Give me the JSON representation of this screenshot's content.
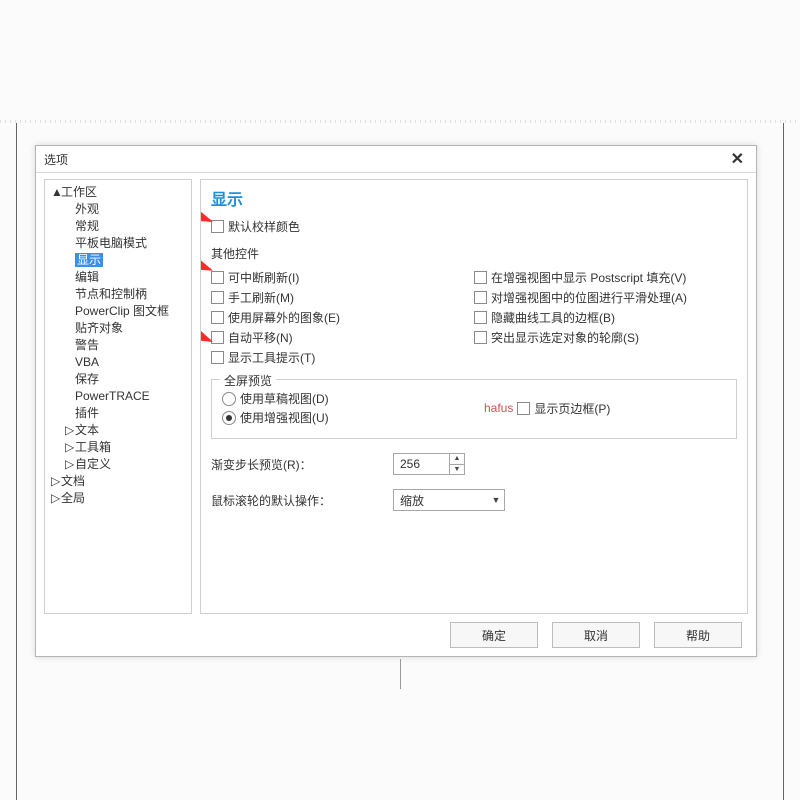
{
  "dialog": {
    "title": "选项"
  },
  "tree": {
    "items": [
      {
        "label": "工作区",
        "level": 0,
        "expander": "▲"
      },
      {
        "label": "外观",
        "level": 1
      },
      {
        "label": "常规",
        "level": 1
      },
      {
        "label": "平板电脑模式",
        "level": 1
      },
      {
        "label": "显示",
        "level": 1,
        "selected": true
      },
      {
        "label": "编辑",
        "level": 1
      },
      {
        "label": "节点和控制柄",
        "level": 1
      },
      {
        "label": "PowerClip 图文框",
        "level": 1
      },
      {
        "label": "贴齐对象",
        "level": 1
      },
      {
        "label": "警告",
        "level": 1
      },
      {
        "label": "VBA",
        "level": 1
      },
      {
        "label": "保存",
        "level": 1
      },
      {
        "label": "PowerTRACE",
        "level": 1
      },
      {
        "label": "插件",
        "level": 1
      },
      {
        "label": "文本",
        "level": 1,
        "expander": "▷"
      },
      {
        "label": "工具箱",
        "level": 1,
        "expander": "▷"
      },
      {
        "label": "自定义",
        "level": 1,
        "expander": "▷"
      },
      {
        "label": "文档",
        "level": 0,
        "expander": "▷"
      },
      {
        "label": "全局",
        "level": 0,
        "expander": "▷"
      }
    ]
  },
  "panel": {
    "heading": "显示",
    "default_proof_color": "默认校样颜色",
    "other_group": "其他控件",
    "left_checks": [
      "可中断刷新(I)",
      "手工刷新(M)",
      "使用屏幕外的图象(E)",
      "自动平移(N)",
      "显示工具提示(T)"
    ],
    "right_checks": [
      "在增强视图中显示 Postscript 填充(V)",
      "对增强视图中的位图进行平滑处理(A)",
      "隐藏曲线工具的边框(B)",
      "突出显示选定对象的轮廓(S)"
    ],
    "fullscreen": {
      "legend": "全屏预览",
      "draft": "使用草稿视图(D)",
      "enhanced": "使用增强视图(U)",
      "show_border": "显示页边框(P)",
      "watermark": "hafus"
    },
    "gradient_label": "渐变步长预览(R)：",
    "gradient_value": "256",
    "wheel_label": "鼠标滚轮的默认操作：",
    "wheel_value": "缩放"
  },
  "buttons": {
    "ok": "确定",
    "cancel": "取消",
    "help": "帮助"
  }
}
